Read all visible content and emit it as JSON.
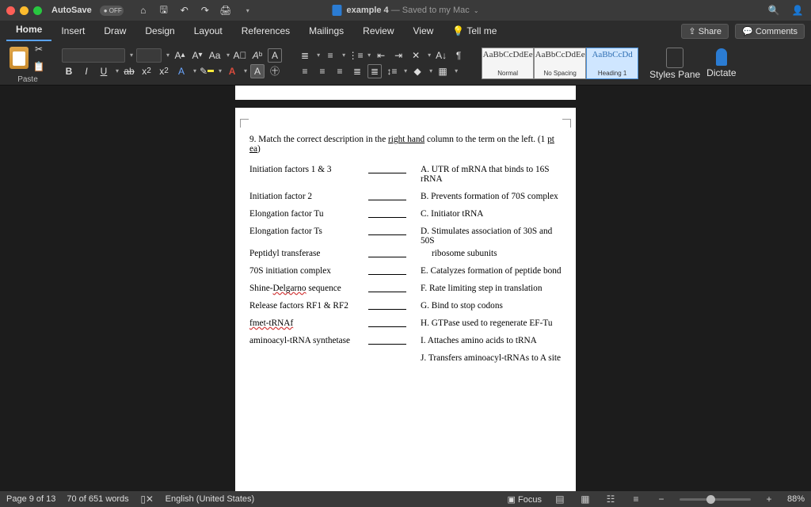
{
  "titlebar": {
    "autosave_label": "AutoSave",
    "autosave_state": "OFF",
    "doc_title": "example 4",
    "saved_text": " — Saved to my Mac"
  },
  "tabs": {
    "items": [
      "Home",
      "Insert",
      "Draw",
      "Design",
      "Layout",
      "References",
      "Mailings",
      "Review",
      "View",
      "Tell me"
    ],
    "share": "Share",
    "comments": "Comments"
  },
  "ribbon": {
    "paste": "Paste",
    "styles": [
      {
        "preview": "AaBbCcDdEe",
        "name": "Normal"
      },
      {
        "preview": "AaBbCcDdEe",
        "name": "No Spacing"
      },
      {
        "preview": "AaBbCcDd",
        "name": "Heading 1"
      }
    ],
    "styles_pane": "Styles Pane",
    "dictate": "Dictate"
  },
  "doc": {
    "q_prefix": "9. Match the correct description in the ",
    "q_underline": "right hand",
    "q_mid": " column to the term on the left. (1 ",
    "q_pt": "pt ea",
    "q_suffix": ")",
    "left": [
      "Initiation factors 1 & 3",
      "Initiation factor 2",
      "Elongation factor Tu",
      "Elongation factor Ts",
      "Peptidyl transferase",
      "70S initiation complex",
      "Release factors RF1 & RF2"
    ],
    "shine_pre": "Shine-",
    "shine_mid": "Delgarno",
    "shine_post": " sequence",
    "fmet": "fmet-tRNAf",
    "aminoacyl": "aminoacyl-tRNA synthetase",
    "right": [
      "A. UTR of mRNA that binds to 16S rRNA",
      "B. Prevents formation of 70S complex",
      "C. Initiator tRNA",
      "D. Stimulates association of 30S and 50S",
      "ribosome subunits",
      "E. Catalyzes formation of peptide bond",
      "F. Rate limiting step in translation",
      "G. Bind to stop codons",
      "H. GTPase used to regenerate EF-Tu",
      "I. Attaches amino acids to tRNA",
      "J. Transfers aminoacyl-tRNAs to A site"
    ]
  },
  "status": {
    "page": "Page 9 of 13",
    "words": "70 of 651 words",
    "lang": "English (United States)",
    "focus": "Focus",
    "zoom": "88%"
  }
}
